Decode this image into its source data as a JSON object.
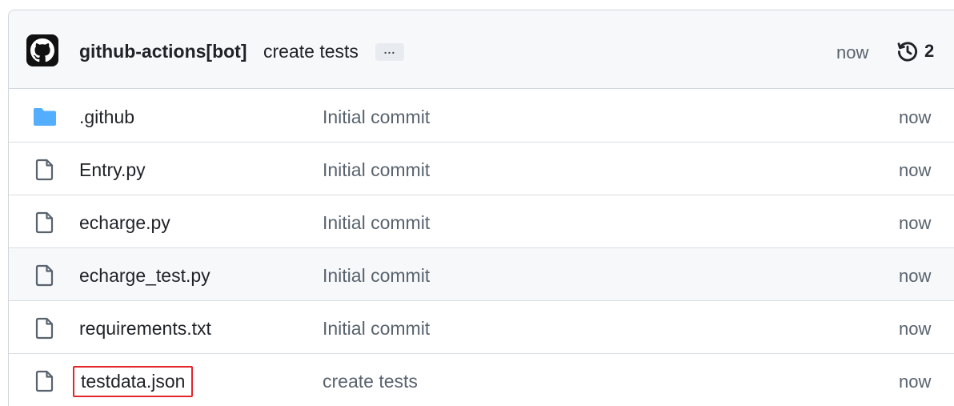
{
  "commit": {
    "author": "github-actions[bot]",
    "message": "create tests",
    "ellipsis": "...",
    "time": "now",
    "history_count": "2"
  },
  "icons": {
    "avatar": "github-octocat-icon",
    "history": "history-clock-icon",
    "folder": "folder-icon",
    "file": "file-icon"
  },
  "colors": {
    "folder": "#54aeff",
    "highlight_border": "#e3262a",
    "muted_text": "#59636e"
  },
  "files": [
    {
      "name": ".github",
      "type": "folder",
      "message": "Initial commit",
      "time": "now"
    },
    {
      "name": "Entry.py",
      "type": "file",
      "message": "Initial commit",
      "time": "now"
    },
    {
      "name": "echarge.py",
      "type": "file",
      "message": "Initial commit",
      "time": "now"
    },
    {
      "name": "echarge_test.py",
      "type": "file",
      "message": "Initial commit",
      "time": "now"
    },
    {
      "name": "requirements.txt",
      "type": "file",
      "message": "Initial commit",
      "time": "now"
    },
    {
      "name": "testdata.json",
      "type": "file",
      "message": "create tests",
      "time": "now"
    }
  ]
}
